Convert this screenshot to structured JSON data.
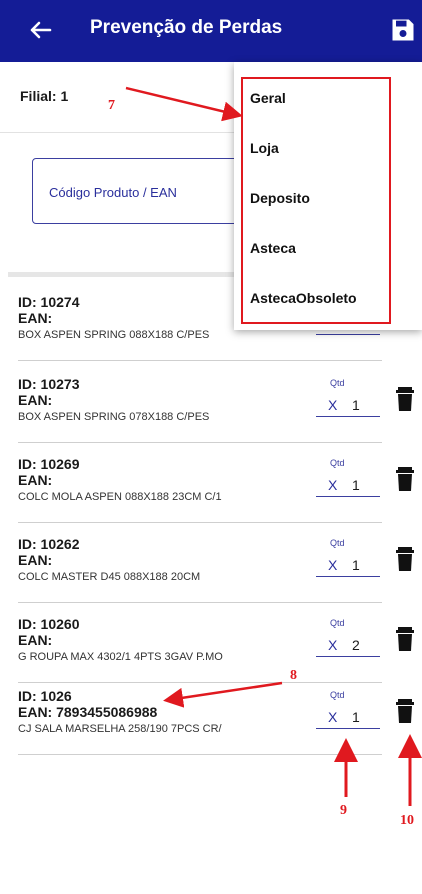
{
  "header": {
    "title": "Prevenção de Perdas"
  },
  "filial": "Filial: 1",
  "search": {
    "placeholder": "Código Produto / EAN"
  },
  "dropdown": {
    "options": [
      "Geral",
      "Loja",
      "Deposito",
      "Asteca",
      "AstecaObsoleto"
    ]
  },
  "items": [
    {
      "id": "ID: 10274",
      "ean": "EAN:",
      "desc": "BOX ASPEN SPRING 088X188 C/PES",
      "qtd_label": "",
      "x": "",
      "qty": ""
    },
    {
      "id": "ID: 10273",
      "ean": "EAN:",
      "desc": "BOX ASPEN SPRING 078X188 C/PES",
      "qtd_label": "Qtd",
      "x": "X",
      "qty": "1"
    },
    {
      "id": "ID: 10269",
      "ean": "EAN:",
      "desc": "COLC MOLA ASPEN 088X188 23CM C/1",
      "qtd_label": "Qtd",
      "x": "X",
      "qty": "1"
    },
    {
      "id": "ID: 10262",
      "ean": "EAN:",
      "desc": "COLC MASTER D45 088X188 20CM",
      "qtd_label": "Qtd",
      "x": "X",
      "qty": "1"
    },
    {
      "id": "ID: 10260",
      "ean": "EAN:",
      "desc": "G ROUPA MAX 4302/1 4PTS 3GAV P.MO",
      "qtd_label": "Qtd",
      "x": "X",
      "qty": "2"
    },
    {
      "id": "ID: 1026",
      "ean": "EAN: 7893455086988",
      "desc": "CJ SALA MARSELHA 258/190 7PCS CR/",
      "qtd_label": "Qtd",
      "x": "X",
      "qty": "1"
    }
  ],
  "annotations": [
    "7",
    "8",
    "9",
    "10"
  ],
  "colors": {
    "header_bg": "#141c96",
    "accent": "#3b3fa0",
    "annotation": "#e0191f"
  },
  "icons": {
    "back": "arrow-left-icon",
    "save": "floppy-disk-icon",
    "trash": "trash-icon"
  }
}
